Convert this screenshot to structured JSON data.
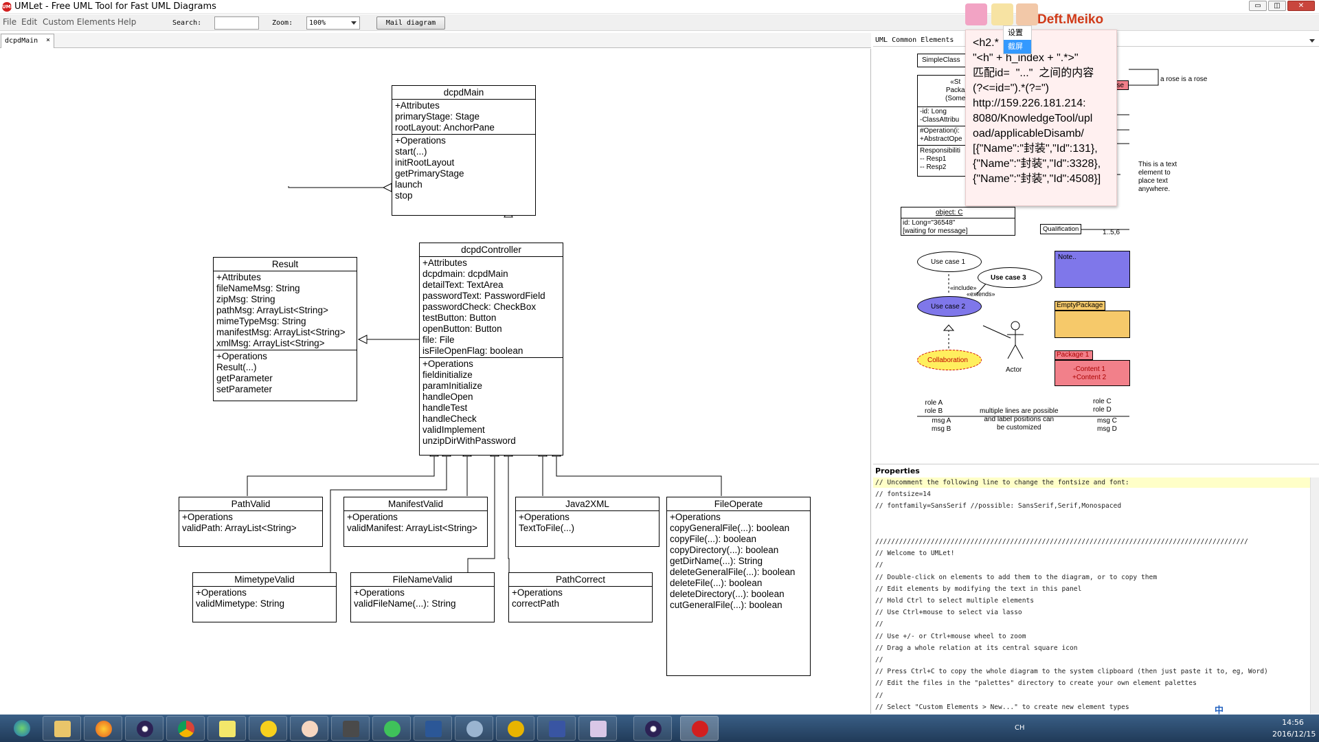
{
  "window": {
    "title": "UMLet - Free UML Tool for Fast UML Diagrams",
    "min": "▭",
    "max": "◫",
    "close": "✕"
  },
  "menu": {
    "file": "File",
    "edit": "Edit",
    "custom": "Custom Elements",
    "help": "Help",
    "search_label": "Search:",
    "zoom_label": "Zoom:",
    "zoom_value": "100%",
    "mail_button": "Mail diagram"
  },
  "tab": {
    "label": "dcpdMain",
    "close": "×"
  },
  "diagram": {
    "dcpdMain": {
      "title": "dcpdMain",
      "attrs": "+Attributes\nprimaryStage: Stage\nrootLayout: AnchorPane",
      "ops": "+Operations\nstart(...)\ninitRootLayout\ngetPrimaryStage\nlaunch\nstop"
    },
    "Result": {
      "title": "Result",
      "attrs": "+Attributes\nfileNameMsg: String\nzipMsg: String\npathMsg: ArrayList<String>\nmimeTypeMsg: String\nmanifestMsg: ArrayList<String>\nxmlMsg: ArrayList<String>",
      "ops": "+Operations\nResult(...)\ngetParameter\nsetParameter"
    },
    "dcpdController": {
      "title": "dcpdController",
      "attrs": "+Attributes\ndcpdmain: dcpdMain\ndetailText: TextArea\npasswordText: PasswordField\npasswordCheck: CheckBox\ntestButton: Button\nopenButton: Button\nfile: File\nisFileOpenFlag: boolean",
      "ops": "+Operations\nfieldinitialize\nparamInitialize\nhandleOpen\nhandleTest\nhandleCheck\nvalidImplement\nunzipDirWithPassword"
    },
    "PathValid": {
      "title": "PathValid",
      "ops": "+Operations\nvalidPath: ArrayList<String>"
    },
    "ManifestValid": {
      "title": "ManifestValid",
      "ops": "+Operations\nvalidManifest: ArrayList<String>"
    },
    "Java2XML": {
      "title": "Java2XML",
      "ops": "+Operations\nTextToFile(...)"
    },
    "FileOperate": {
      "title": "FileOperate",
      "ops": "+Operations\ncopyGeneralFile(...): boolean\ncopyFile(...): boolean\ncopyDirectory(...): boolean\ngetDirName(...): String\ndeleteGeneralFile(...): boolean\ndeleteFile(...): boolean\ndeleteDirectory(...): boolean\ncutGeneralFile(...): boolean"
    },
    "MimetypeValid": {
      "title": "MimetypeValid",
      "ops": "+Operations\nvalidMimetype: String"
    },
    "FileNameValid": {
      "title": "FileNameValid",
      "ops": "+Operations\nvalidFileName(...): String"
    },
    "PathCorrect": {
      "title": "PathCorrect",
      "ops": "+Operations\ncorrectPath"
    }
  },
  "palette": {
    "title": "UML Common Elements",
    "simple_class": "SimpleClass",
    "pkg_head": "«St\nPacka\n(Some",
    "class_attrs": "-id: Long\n-ClassAttribu",
    "class_ops": "#Operation(i:\n+AbstractOpe",
    "class_resp": "Responsibiliti\n-- Resp1\n-- Resp2",
    "rose_text": "a rose is a rose",
    "rose_box": "ose",
    "text_element": "This is a text\nelement to\nplace text\nanywhere.",
    "object_title": "object: C",
    "object_body": "id: Long=\"36548\"\n[waiting for message]",
    "qualification": "Qualification",
    "mult": "1..5,6",
    "usecase1": "Use case 1",
    "usecase2": "Use case 2",
    "usecase3": "Use case 3",
    "include": "«include»",
    "extends": "«extends»",
    "collaboration": "Collaboration",
    "actor": "Actor",
    "note": "Note..",
    "empty_package": "EmptyPackage",
    "package1": "Package 1",
    "package1_content": "-Content 1\n+Content 2",
    "role_ab": "role A\nrole B",
    "role_cd": "role C\nrole D",
    "multiline": "multiple lines are possible\nand label positions can\nbe customized",
    "msg_ab": "msg A\nmsg B",
    "msg_cd": "msg C\nmsg D"
  },
  "properties": {
    "title": "Properties",
    "lines": [
      "// Uncomment the following line to change the fontsize and font:",
      "// fontsize=14",
      "// fontfamily=SansSerif //possible: SansSerif,Serif,Monospaced",
      "",
      "",
      "//////////////////////////////////////////////////////////////////////////////////////////////",
      "// Welcome to UMLet!",
      "//",
      "// Double-click on elements to add them to the diagram, or to copy them",
      "// Edit elements by modifying the text in this panel",
      "// Hold Ctrl to select multiple elements",
      "// Use Ctrl+mouse to select via lasso",
      "//",
      "// Use +/- or Ctrl+mouse wheel to zoom",
      "// Drag a whole relation at its central square icon",
      "//",
      "// Press Ctrl+C to copy the whole diagram to the system clipboard (then just paste it to, eg, Word)",
      "// Edit the files in the \"palettes\" directory to create your own element palettes",
      "//",
      "// Select \"Custom Elements > New...\" to create new element types"
    ]
  },
  "popup": {
    "text": "<h2.*\n\"<h\" + h_index + \".*>\"\n匹配id=  \"...\"  之间的内容\n(?<=id=\").*(?=\")\nhttp://159.226.181.214:\n8080/KnowledgeTool/upl\noad/applicableDisamb/\n[{\"Name\":\"封装\",\"Id\":131},\n{\"Name\":\"封装\",\"Id\":3328},\n{\"Name\":\"封装\",\"Id\":4508}]",
    "menu_settings": "设置",
    "menu_screenshot": "截屏",
    "brand": "Deft.Meiko"
  },
  "taskbar": {
    "clock_time": "14:56",
    "clock_date": "2016/12/15",
    "lang": "CH",
    "ime": "中"
  }
}
